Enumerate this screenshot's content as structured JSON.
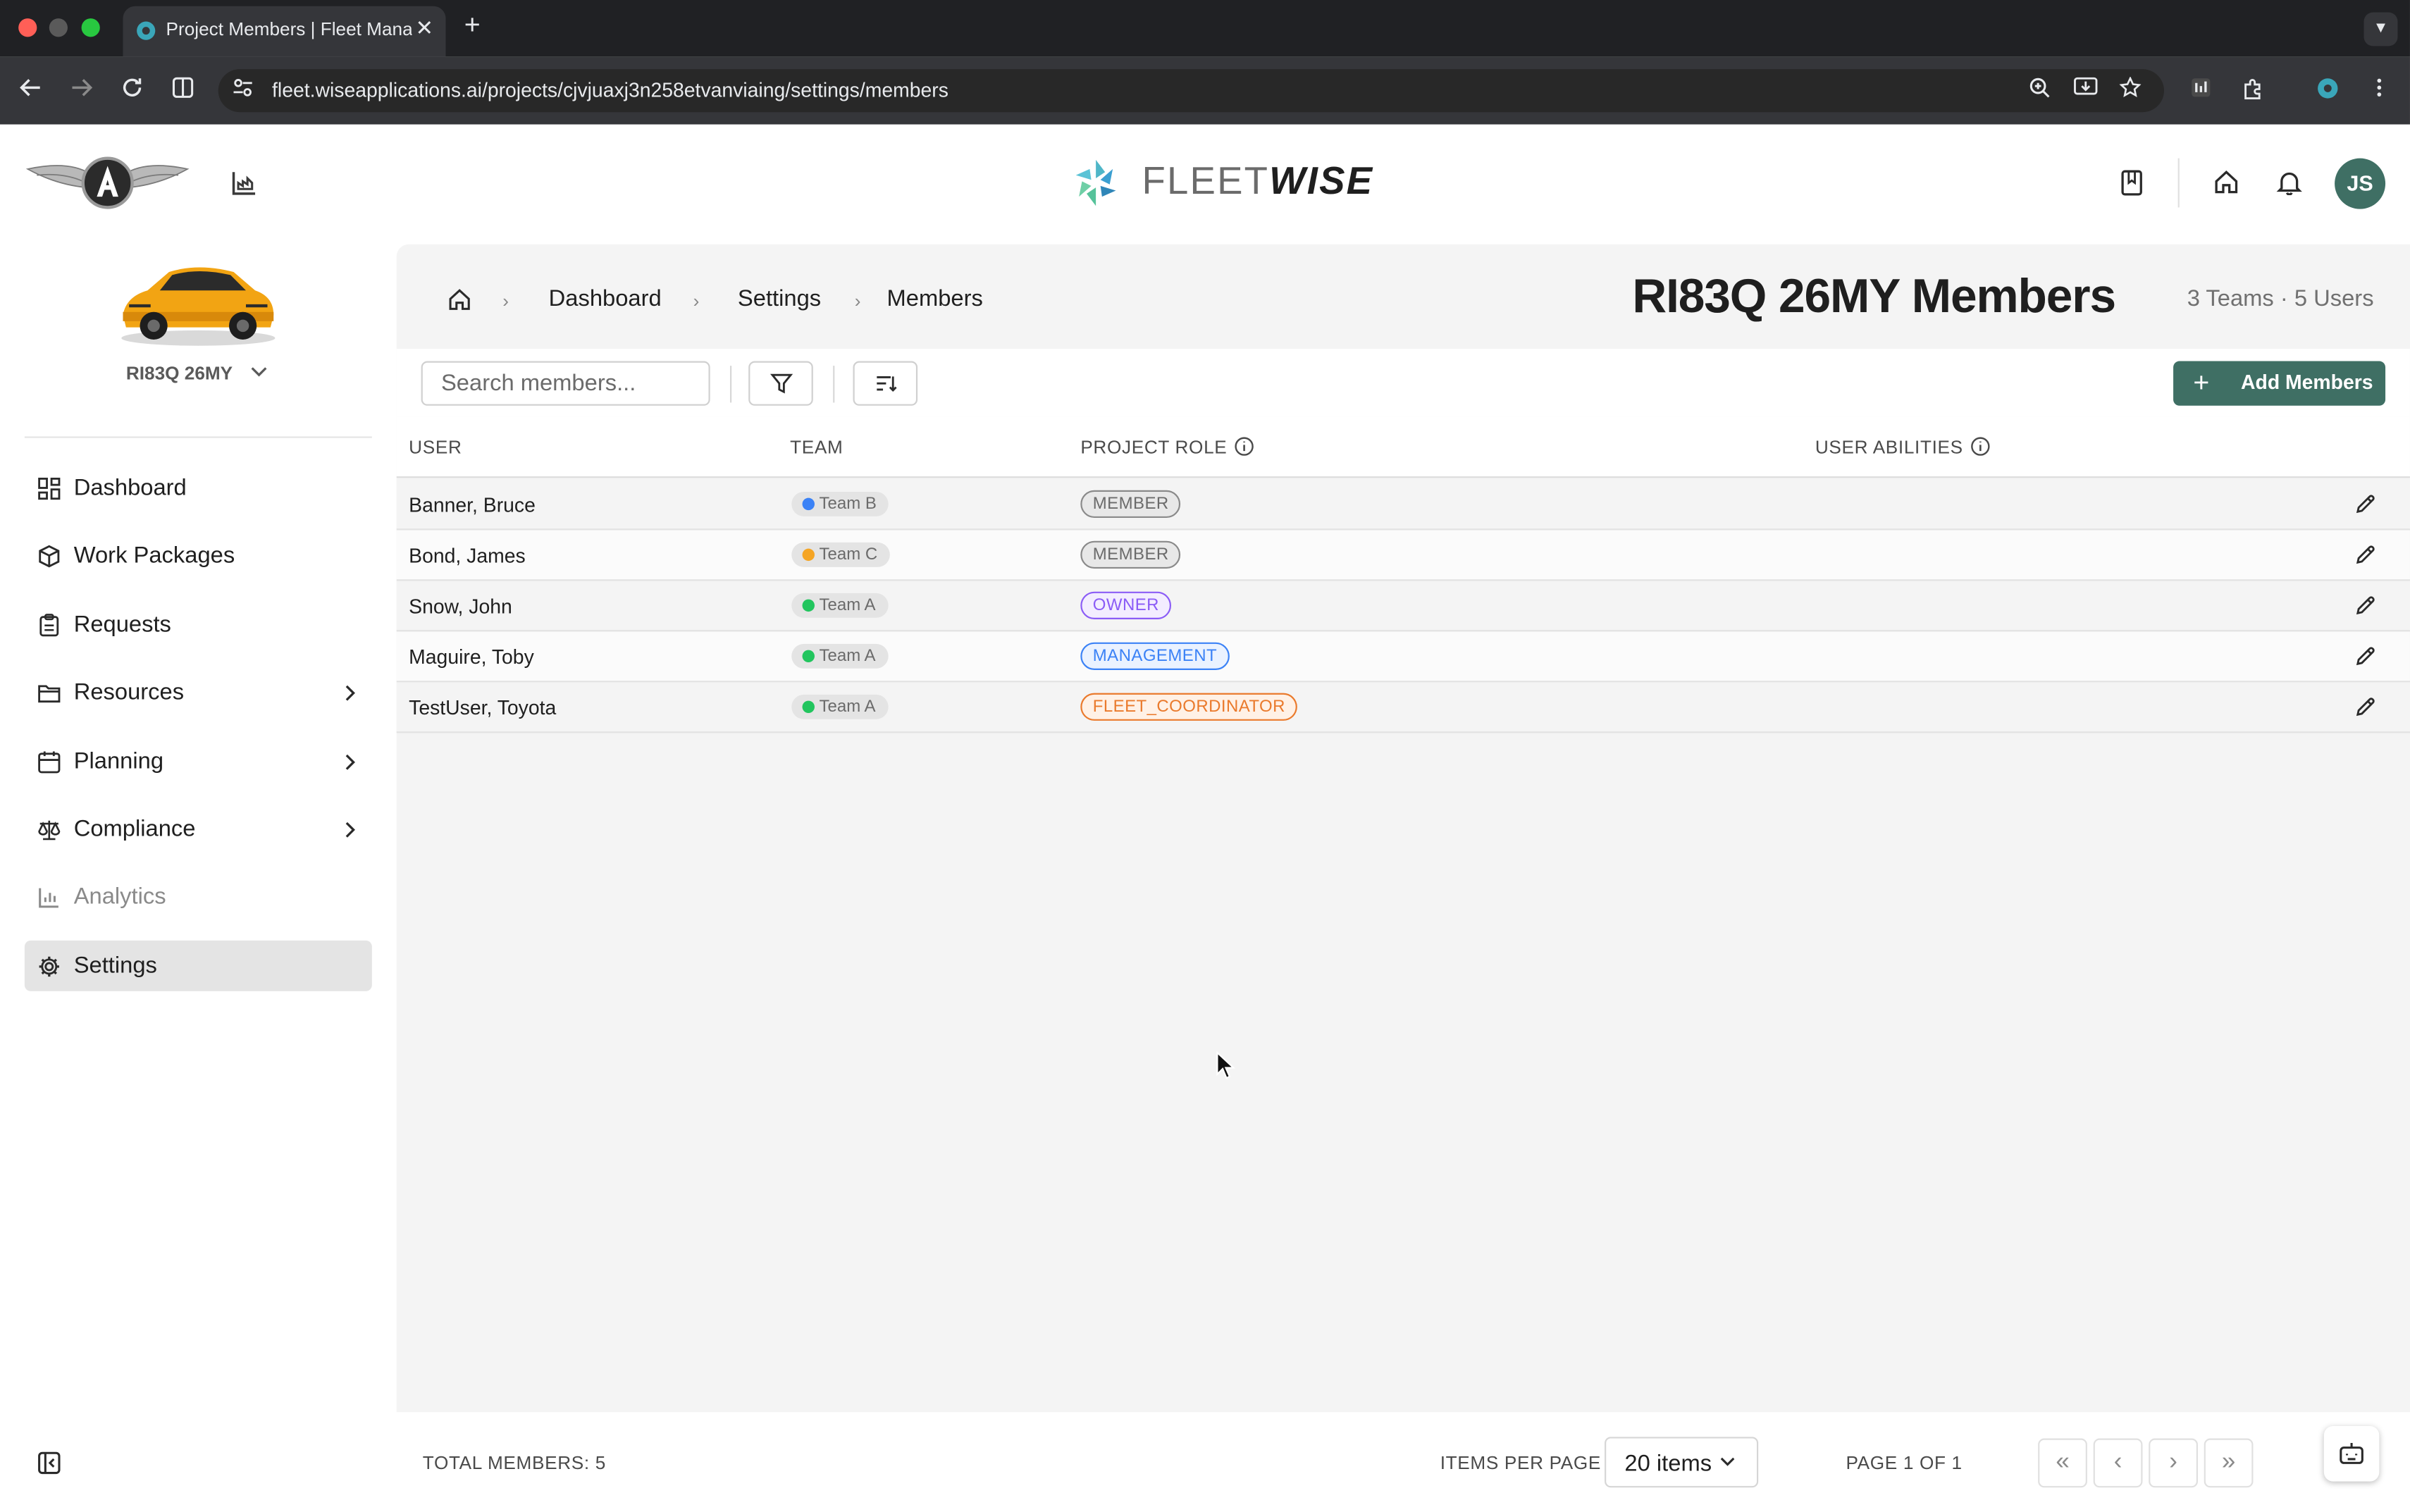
{
  "browser": {
    "tab_title": "Project Members | Fleet Mana",
    "url": "fleet.wiseapplications.ai/projects/cjvjuaxj3n258etvanviaing/settings/members",
    "new_tab": "+",
    "tab_close": "✕"
  },
  "header": {
    "brand_light": "FLEET",
    "brand_bold": "WISE",
    "avatar_initials": "JS"
  },
  "sidebar": {
    "project_name": "RI83Q 26MY",
    "items": [
      {
        "label": "Dashboard",
        "icon": "dashboard-icon",
        "chevron": false,
        "active": false,
        "disabled": false
      },
      {
        "label": "Work Packages",
        "icon": "package-icon",
        "chevron": false,
        "active": false,
        "disabled": false
      },
      {
        "label": "Requests",
        "icon": "clipboard-icon",
        "chevron": false,
        "active": false,
        "disabled": false
      },
      {
        "label": "Resources",
        "icon": "folder-icon",
        "chevron": true,
        "active": false,
        "disabled": false
      },
      {
        "label": "Planning",
        "icon": "calendar-icon",
        "chevron": true,
        "active": false,
        "disabled": false
      },
      {
        "label": "Compliance",
        "icon": "scale-icon",
        "chevron": true,
        "active": false,
        "disabled": false
      },
      {
        "label": "Analytics",
        "icon": "bar-chart-icon",
        "chevron": false,
        "active": false,
        "disabled": true
      },
      {
        "label": "Settings",
        "icon": "gear-icon",
        "chevron": false,
        "active": true,
        "disabled": false
      }
    ]
  },
  "breadcrumb": {
    "items": [
      "Dashboard",
      "Settings",
      "Members"
    ]
  },
  "page": {
    "title": "RI83Q 26MY Members",
    "subtitle": "3 Teams · 5 Users"
  },
  "controls": {
    "search_placeholder": "Search members...",
    "add_label": "Add Members"
  },
  "table": {
    "columns": [
      "USER",
      "TEAM",
      "PROJECT ROLE",
      "USER ABILITIES"
    ],
    "rows": [
      {
        "user": "Banner, Bruce",
        "team": "Team B",
        "team_color": "#3b82f6",
        "role": "MEMBER",
        "role_style": "member"
      },
      {
        "user": "Bond, James",
        "team": "Team C",
        "team_color": "#f5a524",
        "role": "MEMBER",
        "role_style": "member"
      },
      {
        "user": "Snow, John",
        "team": "Team A",
        "team_color": "#22c55e",
        "role": "OWNER",
        "role_style": "owner"
      },
      {
        "user": "Maguire, Toby",
        "team": "Team A",
        "team_color": "#22c55e",
        "role": "MANAGEMENT",
        "role_style": "management"
      },
      {
        "user": "TestUser, Toyota",
        "team": "Team A",
        "team_color": "#22c55e",
        "role": "FLEET_COORDINATOR",
        "role_style": "coordinator"
      }
    ]
  },
  "footer": {
    "total_label": "TOTAL MEMBERS: 5",
    "items_per_page_label": "ITEMS PER PAGE",
    "items_per_page_value": "20 items",
    "page_info": "PAGE 1 OF 1"
  },
  "colors": {
    "accent": "#3f6f64",
    "owner": "#8b5cf6",
    "management": "#3b82f6",
    "coordinator": "#ea7a2c",
    "member": "#6b6b6b"
  }
}
